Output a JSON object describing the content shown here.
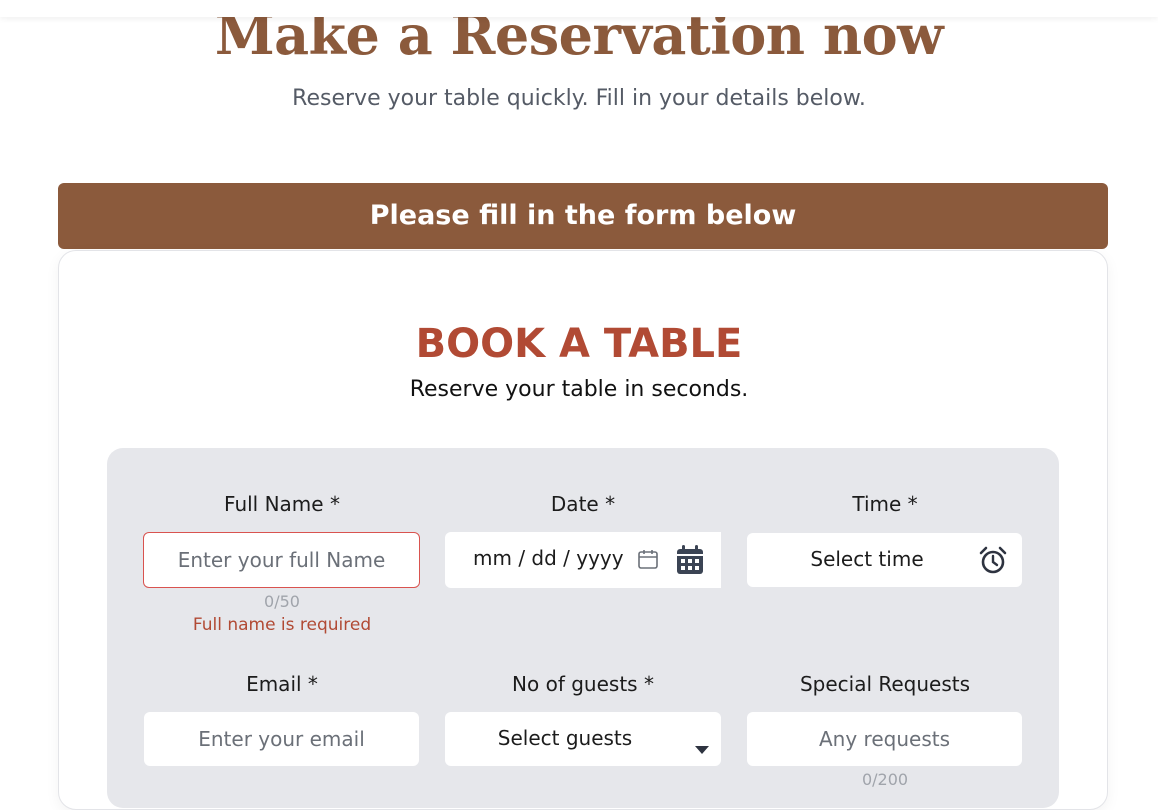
{
  "hero": {
    "title": "Make a Reservation now",
    "subtitle": "Reserve your table quickly. Fill in your details below."
  },
  "banner": {
    "text": "Please fill in the form below"
  },
  "booking": {
    "title": "BOOK A TABLE",
    "subtitle": "Reserve your table in seconds."
  },
  "form": {
    "full_name": {
      "label": "Full Name *",
      "placeholder": "Enter your full Name",
      "value": "",
      "counter": "0/50",
      "error": "Full name is required"
    },
    "date": {
      "label": "Date *",
      "value": "mm / dd / yyyy",
      "calendar_icon": "calendar-icon"
    },
    "time": {
      "label": "Time *",
      "value": "Select time",
      "icon": "alarm-clock-icon"
    },
    "email": {
      "label": "Email *",
      "placeholder": "Enter your email",
      "value": ""
    },
    "guests": {
      "label": "No of guests *",
      "value": "Select guests",
      "icon": "chevron-down-icon"
    },
    "special_requests": {
      "label": "Special Requests",
      "placeholder": "Any requests",
      "value": "",
      "counter": "0/200"
    }
  },
  "colors": {
    "brand_brown": "#8b5a3c",
    "accent_red": "#b14a34",
    "panel_bg": "#e6e7eb",
    "error_border": "#d9534f"
  }
}
